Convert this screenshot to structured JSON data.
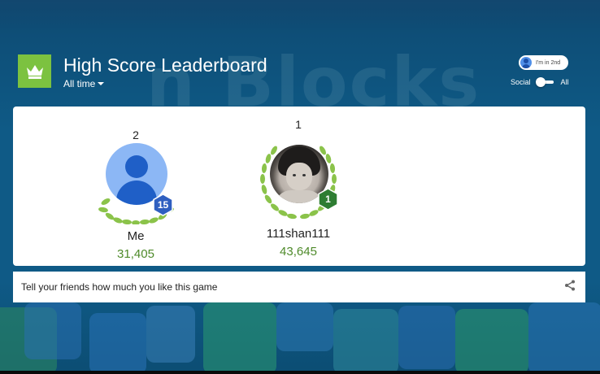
{
  "header": {
    "title": "High Score Leaderboard",
    "time_filter": "All time",
    "rank_pill": "I'm in 2nd"
  },
  "toggle": {
    "left_label": "Social",
    "right_label": "All"
  },
  "leaderboard": {
    "players": [
      {
        "rank": "2",
        "name": "Me",
        "score": "31,405",
        "level": "15",
        "badge_color": "#2f5fc0"
      },
      {
        "rank": "1",
        "name": "111shan111",
        "score": "43,645",
        "level": "1",
        "badge_color": "#2e7d32"
      }
    ]
  },
  "share": {
    "text": "Tell your friends how much you like this game"
  },
  "background": {
    "title": "n Blocks"
  },
  "colors": {
    "app_icon": "#7cc240",
    "score_green": "#4e8a2a",
    "wreath_green": "#8bc34a"
  }
}
